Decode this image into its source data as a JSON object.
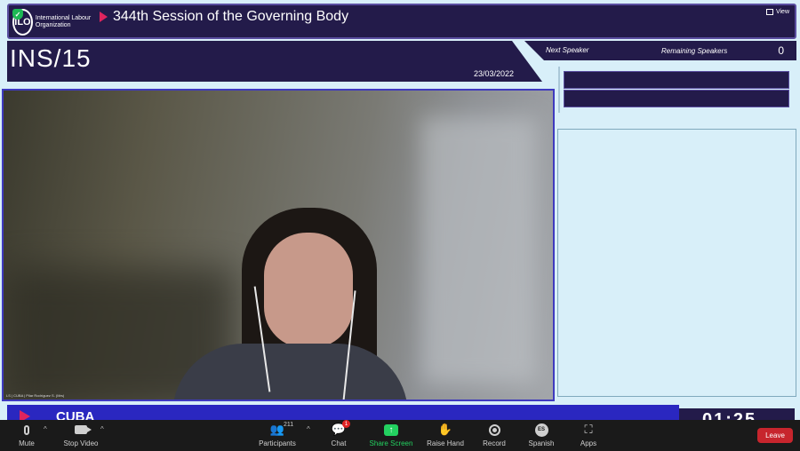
{
  "header": {
    "org_name": "International Labour Organization",
    "logo_text": "ILO",
    "session_title": "344th Session of the Governing Body",
    "view_label": "View"
  },
  "agenda": {
    "code": "INS/15",
    "date": "23/03/2022"
  },
  "speakers": {
    "next_label": "Next Speaker",
    "remaining_label": "Remaining Speakers",
    "remaining_count": "0"
  },
  "video": {
    "caption": "LS | CUBA | Pilar Rodríguez S. (Mrs)"
  },
  "country": {
    "name": "CUBA",
    "timer": "01:25"
  },
  "toolbar": {
    "mute_label": "Mute",
    "stop_video_label": "Stop Video",
    "participants_label": "Participants",
    "participants_count": "211",
    "chat_label": "Chat",
    "chat_badge": "1",
    "share_screen_label": "Share Screen",
    "raise_hand_label": "Raise Hand",
    "record_label": "Record",
    "language_label": "Spanish",
    "language_code": "ES",
    "apps_label": "Apps",
    "leave_label": "Leave"
  },
  "colors": {
    "navy": "#231b4a",
    "accent_blue": "#2a27c0",
    "accent_pink": "#e0245e",
    "panel_bg": "#d8eff9",
    "leave_red": "#c7252d",
    "share_green": "#23d160"
  }
}
